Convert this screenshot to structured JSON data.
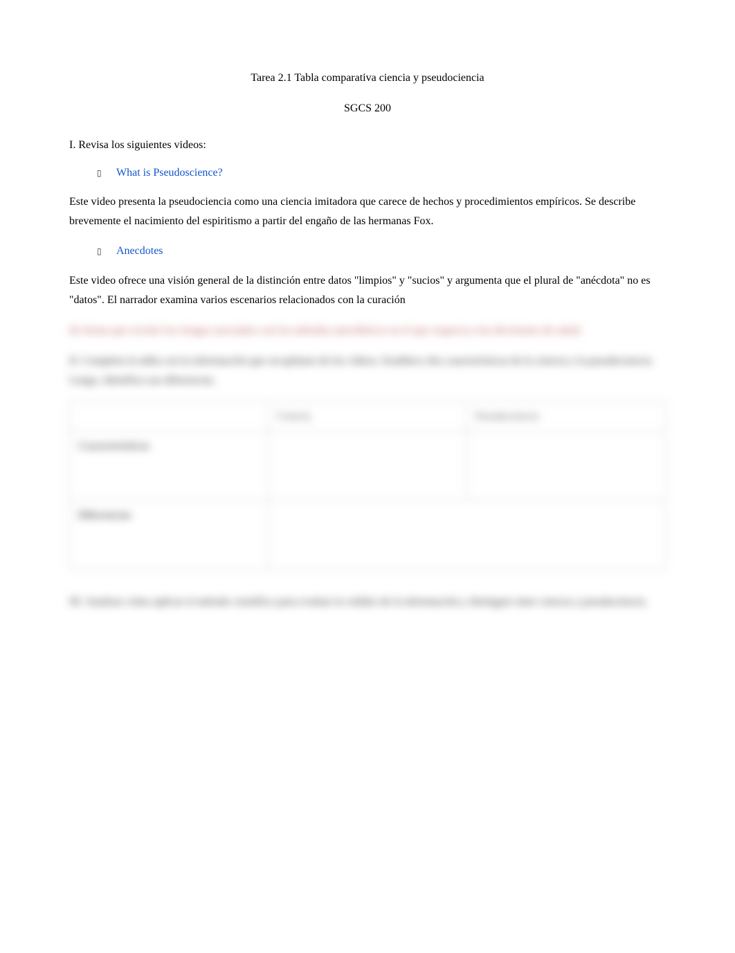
{
  "title": "Tarea 2.1 Tabla comparativa ciencia y pseudociencia",
  "subtitle": "SGCS 200",
  "section1": {
    "heading": "I. Revisa los siguientes videos:",
    "items": [
      {
        "link_text": "What is Pseudoscience?",
        "description": "Este video presenta la pseudociencia como una ciencia imitadora que carece de hechos y procedimientos empíricos. Se describe brevemente el nacimiento del espiritismo a partir del engaño de las hermanas Fox."
      },
      {
        "link_text": "Anecdotes",
        "description": "Este video ofrece una visión general de la distinción entre datos \"limpios\" y \"sucios\" y argumenta que el plural de \"anécdota\" no es \"datos\". El narrador examina varios escenarios relacionados con la curación"
      }
    ]
  },
  "blurred": {
    "para1": "de forma que revelar los riesgos asociados con los métodos anecdóticos en el que respecta a las decisiones de salud.",
    "para2": "II. Completa la tabla con la información que recopilaste de los vídeos. Establece dos características de la ciencia y la pseudociencia. Luego, identifica sus diferencias.",
    "table": {
      "headers": [
        "",
        "Ciencia",
        "Pseudociencia"
      ],
      "rows": [
        {
          "label": "Características",
          "col1": "",
          "col2": ""
        },
        {
          "label": "Diferencias",
          "merged": ""
        }
      ]
    },
    "para3": "III. Analizar cómo aplicar el método científico para evaluar la validez de la información y distinguir entre ciencia y pseudociencia."
  }
}
